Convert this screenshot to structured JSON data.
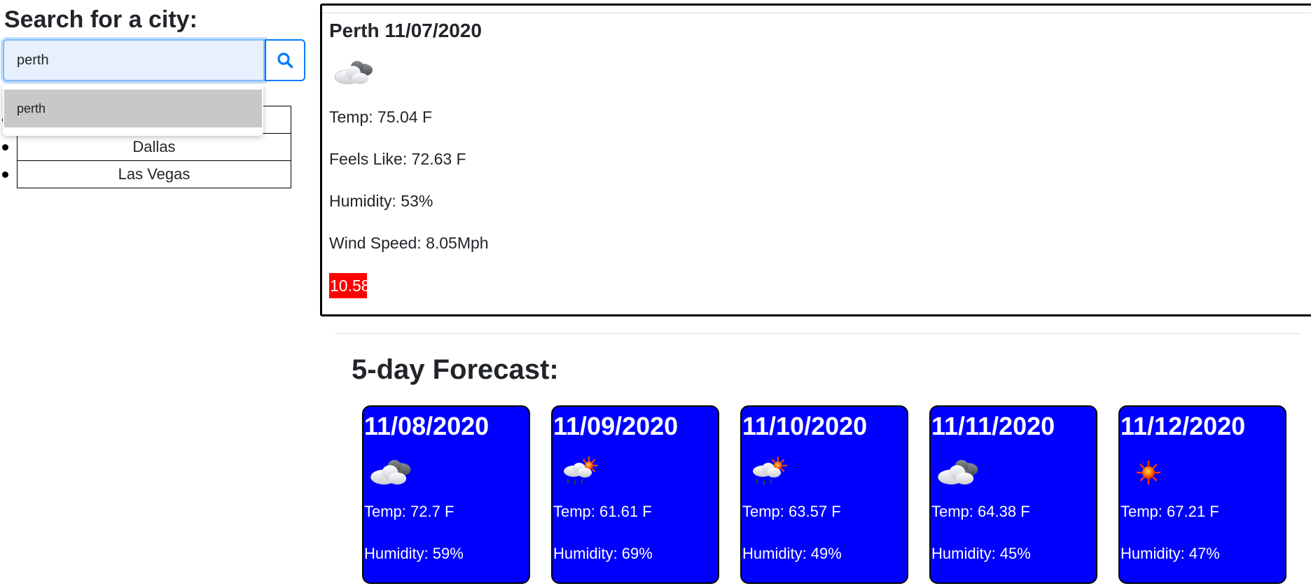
{
  "search": {
    "title": "Search for a city:",
    "value": "perth",
    "button_icon": "search-icon",
    "suggestion": "perth"
  },
  "history": [
    {
      "label": "Dallas"
    },
    {
      "label": "Las Vegas"
    }
  ],
  "current": {
    "title": "Perth 11/07/2020",
    "icon": "partly-cloudy-icon",
    "temp": "Temp: 75.04 F",
    "feels_like": "Feels Like: 72.63 F",
    "humidity": "Humidity: 53%",
    "wind": "Wind Speed: 8.05Mph",
    "uv_index": "10.58",
    "uv_color": "#ff0000"
  },
  "forecast": {
    "title": "5-day Forecast:",
    "card_color": "#0000ff",
    "days": [
      {
        "date": "11/08/2020",
        "icon": "partly-cloudy-icon",
        "temp": "Temp: 72.7 F",
        "humidity": "Humidity: 59%"
      },
      {
        "date": "11/09/2020",
        "icon": "sun-rain-icon",
        "temp": "Temp: 61.61 F",
        "humidity": "Humidity: 69%"
      },
      {
        "date": "11/10/2020",
        "icon": "sun-rain-icon",
        "temp": "Temp: 63.57 F",
        "humidity": "Humidity: 49%"
      },
      {
        "date": "11/11/2020",
        "icon": "partly-cloudy-icon",
        "temp": "Temp: 64.38 F",
        "humidity": "Humidity: 45%"
      },
      {
        "date": "11/12/2020",
        "icon": "sun-icon",
        "temp": "Temp: 67.21 F",
        "humidity": "Humidity: 47%"
      }
    ]
  }
}
